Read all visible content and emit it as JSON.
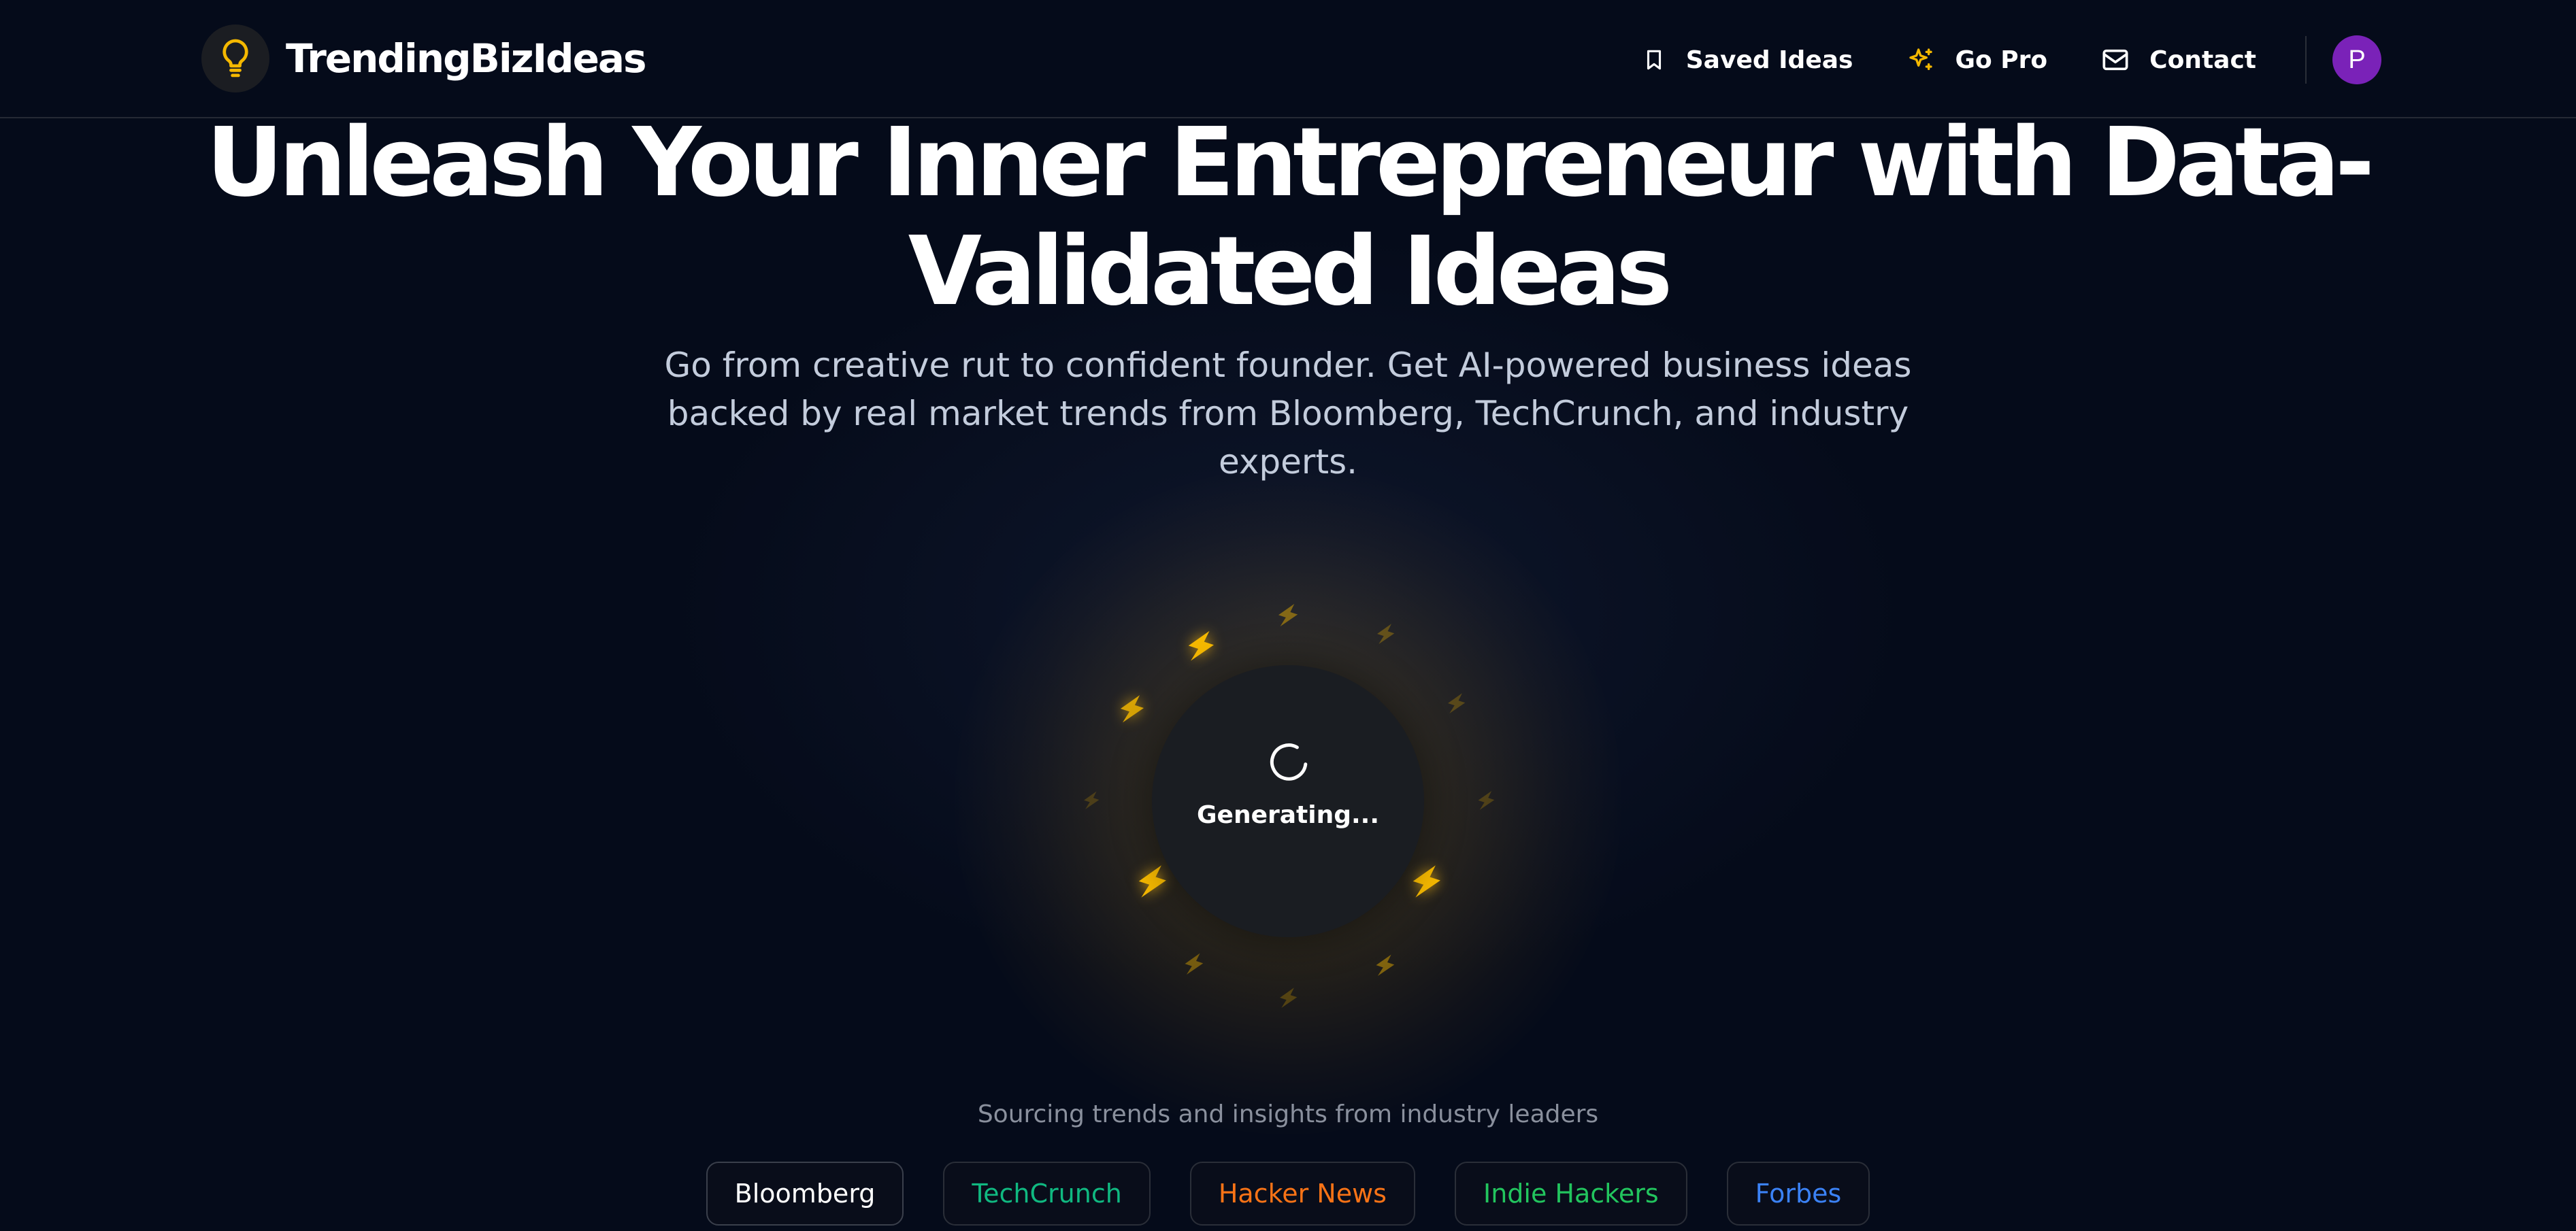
{
  "header": {
    "brand": "TrendingBizIdeas",
    "nav": [
      {
        "label": "Saved Ideas",
        "icon": "bookmark-icon"
      },
      {
        "label": "Go Pro",
        "icon": "sparkles-icon"
      },
      {
        "label": "Contact",
        "icon": "mail-icon"
      }
    ],
    "avatar_initial": "P",
    "avatar_color": "#7a22b8",
    "accent_color": "#f5b800"
  },
  "hero": {
    "title_line1": "Unleash Your Inner Entrepreneur with Data-",
    "title_line2": "Validated Ideas",
    "subtitle": "Go from creative rut to confident founder. Get AI-powered business ideas backed by real market trends from Bloomberg, TechCrunch, and industry experts."
  },
  "generator": {
    "status": "Generating..."
  },
  "sources": {
    "label": "Sourcing trends and insights from industry leaders",
    "chips": [
      {
        "label": "Bloomberg",
        "color": "#ffffff"
      },
      {
        "label": "TechCrunch",
        "color": "#10b981"
      },
      {
        "label": "Hacker News",
        "color": "#f97316"
      },
      {
        "label": "Indie Hackers",
        "color": "#22c55e"
      },
      {
        "label": "Forbes",
        "color": "#3b82f6"
      }
    ]
  }
}
